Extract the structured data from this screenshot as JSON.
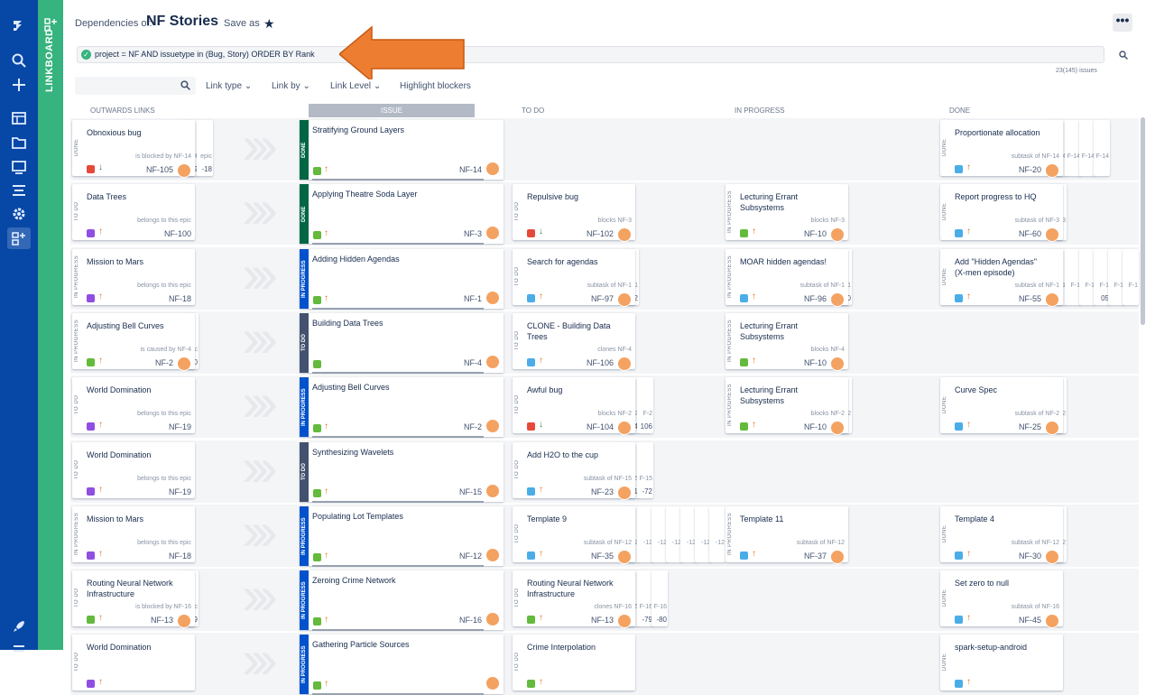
{
  "nav": {
    "items": [
      "jira-logo-icon",
      "search-icon",
      "create-icon",
      "boards-icon",
      "projects-icon",
      "dashboards-icon",
      "filters-icon",
      "settings-icon",
      "linkboard-icon"
    ],
    "bottom": [
      "rocket-icon",
      "menu-icon"
    ]
  },
  "sidebar": {
    "label": "LINKBOARD"
  },
  "header": {
    "prefix": "Dependencies of:",
    "title": "NF Stories",
    "save_as": "Save as",
    "more": "•••"
  },
  "jql": {
    "query": "project = NF AND issuetype in (Bug, Story) ORDER BY Rank",
    "count": "23(145) issues"
  },
  "filters": {
    "link_type": "Link type",
    "link_by": "Link by",
    "link_level": "Link Level",
    "highlight": "Highlight blockers"
  },
  "columns": {
    "outwards": "OUTWARDS LINKS",
    "issue": "ISSUE",
    "todo": "TO DO",
    "in_progress": "IN PROGRESS",
    "done": "DONE"
  },
  "colors": {
    "nav": "#0747a6",
    "sidebar": "#36b37e",
    "done_bar": "#006644",
    "in_progress_bar": "#0052cc",
    "todo_bar": "#42526e",
    "arrow": "#ed7d31"
  },
  "rows": [
    {
      "out": {
        "status": "DONE",
        "title": "Obnoxious bug",
        "sub": "is blocked by NF-14",
        "key": "NF-105",
        "type": "bug",
        "prio": "low",
        "ghosts": [
          {
            "s": "F-14",
            "k": "-99"
          },
          {
            "s": "epic",
            "k": "-18"
          }
        ]
      },
      "issue": {
        "status": "DONE",
        "title": "Stratifying Ground Layers",
        "key": "NF-14",
        "type": "story",
        "prio": "high"
      },
      "todo": null,
      "inprog": null,
      "done": {
        "status": "DONE",
        "title": "Proportionate allocation",
        "sub": "subtask of NF-14",
        "key": "NF-20",
        "type": "subtask",
        "prio": "high",
        "ghosts": [
          {
            "s": "F-14",
            "k": ""
          },
          {
            "s": "F-14",
            "k": ""
          },
          {
            "s": "F-14",
            "k": ""
          },
          {
            "s": "F-14",
            "k": ""
          }
        ]
      }
    },
    {
      "out": {
        "status": "TO DO",
        "title": "Data Trees",
        "sub": "belongs to this epic",
        "key": "NF-100",
        "type": "epic",
        "prio": "high"
      },
      "issue": {
        "status": "DONE",
        "title": "Applying Theatre Soda Layer",
        "key": "NF-3",
        "type": "story",
        "prio": "high"
      },
      "todo": {
        "status": "TO DO",
        "title": "Repulsive bug",
        "sub": "blocks NF-3",
        "key": "NF-102",
        "type": "bug",
        "prio": "low"
      },
      "inprog": {
        "status": "IN PROGRESS",
        "title": "Lecturing Errant Subsystems",
        "sub": "blocks NF-3",
        "key": "NF-10",
        "type": "story",
        "prio": "high"
      },
      "done": {
        "status": "DONE",
        "title": "Report progress to HQ",
        "sub": "subtask of NF-3",
        "key": "NF-60",
        "type": "subtask",
        "prio": "high",
        "ghosts": [
          {
            "s": "F-3",
            "k": ""
          }
        ]
      }
    },
    {
      "out": {
        "status": "IN PROGRESS",
        "title": "Mission to Mars",
        "sub": "belongs to this epic",
        "key": "NF-18",
        "type": "epic",
        "prio": "high"
      },
      "issue": {
        "status": "IN PROGRESS",
        "title": "Adding Hidden Agendas",
        "key": "NF-1",
        "type": "story",
        "prio": "high"
      },
      "todo": {
        "status": "TO DO",
        "title": "Search for agendas",
        "sub": "subtask of NF-1",
        "key": "NF-97",
        "type": "subtask",
        "prio": "high",
        "ghosts": [
          {
            "s": "F-1",
            "k": "102"
          }
        ]
      },
      "inprog": {
        "status": "IN PROGRESS",
        "title": "MOAR hidden agendas!",
        "sub": "subtask of NF-1",
        "key": "NF-96",
        "type": "subtask",
        "prio": "high",
        "ghosts": [
          {
            "s": "F-1",
            "k": "-10"
          }
        ]
      },
      "done": {
        "status": "DONE",
        "title": "Add \"Hidden Agendas\" (X-men episode)",
        "sub": "subtask of NF-1",
        "key": "NF-55",
        "type": "subtask",
        "prio": "high",
        "ghosts": [
          {
            "s": "F-1",
            "k": ""
          },
          {
            "s": "F-1",
            "k": ""
          },
          {
            "s": "F-1",
            "k": ""
          },
          {
            "s": "F-1",
            "k": "05"
          },
          {
            "s": "F-1",
            "k": ""
          },
          {
            "s": "F-1",
            "k": ""
          }
        ]
      }
    },
    {
      "out": {
        "status": "IN PROGRESS",
        "title": "Adjusting Bell Curves",
        "sub": "is caused by NF-4",
        "key": "NF-2",
        "type": "story",
        "prio": "high",
        "ghosts": [
          {
            "s": "epic",
            "k": "100"
          }
        ]
      },
      "issue": {
        "status": "TO DO",
        "title": "Building Data Trees",
        "key": "NF-4",
        "type": "story",
        "prio": "none"
      },
      "todo": {
        "status": "TO DO",
        "title": "CLONE - Building Data Trees",
        "sub": "clones NF-4",
        "key": "NF-106",
        "type": "task",
        "prio": "high"
      },
      "inprog": {
        "status": "IN PROGRESS",
        "title": "Lecturing Errant Subsystems",
        "sub": "blocks NF-4",
        "key": "NF-10",
        "type": "story",
        "prio": "high"
      },
      "done": null
    },
    {
      "out": {
        "status": "TO DO",
        "title": "World Domination",
        "sub": "belongs to this epic",
        "key": "NF-19",
        "type": "epic",
        "prio": "high"
      },
      "issue": {
        "status": "IN PROGRESS",
        "title": "Adjusting Bell Curves",
        "key": "NF-2",
        "type": "story",
        "prio": "high"
      },
      "todo": {
        "status": "TO DO",
        "title": "Awful bug",
        "sub": "blocks NF-2",
        "key": "NF-104",
        "type": "bug",
        "prio": "low",
        "ghosts": [
          {
            "s": "F-2",
            "k": "-4"
          },
          {
            "s": "F-2",
            "k": "106"
          }
        ]
      },
      "inprog": {
        "status": "IN PROGRESS",
        "title": "Lecturing Errant Subsystems",
        "sub": "blocks NF-2",
        "key": "NF-10",
        "type": "story",
        "prio": "high",
        "ghosts": [
          {
            "s": "F-2",
            "k": ""
          }
        ]
      },
      "done": {
        "status": "DONE",
        "title": "Curve Spec",
        "sub": "subtask of NF-2",
        "key": "NF-25",
        "type": "subtask",
        "prio": "high",
        "ghosts": [
          {
            "s": "F-2",
            "k": ""
          }
        ]
      }
    },
    {
      "out": {
        "status": "TO DO",
        "title": "World Domination",
        "sub": "belongs to this epic",
        "key": "NF-19",
        "type": "epic",
        "prio": "high"
      },
      "issue": {
        "status": "TO DO",
        "title": "Synthesizing Wavelets",
        "key": "NF-15",
        "type": "story",
        "prio": "high"
      },
      "todo": {
        "status": "TO DO",
        "title": "Add H2O to the cup",
        "sub": "subtask of NF-15",
        "key": "NF-23",
        "type": "subtask",
        "prio": "high",
        "ghosts": [
          {
            "s": "F-15",
            "k": "-71"
          },
          {
            "s": "F-15",
            "k": "-72"
          }
        ]
      },
      "inprog": null,
      "done": null
    },
    {
      "out": {
        "status": "IN PROGRESS",
        "title": "Mission to Mars",
        "sub": "belongs to this epic",
        "key": "NF-18",
        "type": "epic",
        "prio": "high"
      },
      "issue": {
        "status": "IN PROGRESS",
        "title": "Populating Lot Templates",
        "key": "NF-12",
        "type": "story",
        "prio": "high"
      },
      "todo": {
        "status": "TO DO",
        "title": "Template 9",
        "sub": "subtask of NF-12",
        "key": "NF-35",
        "type": "subtask",
        "prio": "high",
        "ghosts": [
          {
            "s": "-12",
            "k": ""
          },
          {
            "s": "-12",
            "k": ""
          },
          {
            "s": "-12",
            "k": ""
          },
          {
            "s": "-12",
            "k": ""
          },
          {
            "s": "-12",
            "k": ""
          },
          {
            "s": "-12",
            "k": ""
          },
          {
            "s": "-12",
            "k": ""
          }
        ]
      },
      "inprog": {
        "status": "IN PROGRESS",
        "title": "Template 11",
        "sub": "subtask of NF-12",
        "key": "NF-37",
        "type": "subtask",
        "prio": "high"
      },
      "done": {
        "status": "DONE",
        "title": "Template 4",
        "sub": "subtask of NF-12",
        "key": "NF-30",
        "type": "subtask",
        "prio": "high",
        "ghosts": [
          {
            "s": "F-12",
            "k": ""
          }
        ]
      }
    },
    {
      "out": {
        "status": "TO DO",
        "title": "Routing Neural Network Infrastructure",
        "sub": "is blocked by NF-16",
        "key": "NF-13",
        "type": "story",
        "prio": "high",
        "ghosts": [
          {
            "s": "epic",
            "k": "-99"
          }
        ]
      },
      "issue": {
        "status": "IN PROGRESS",
        "title": "Zeroing Crime Network",
        "key": "NF-16",
        "type": "story",
        "prio": "high"
      },
      "todo": {
        "status": "TO DO",
        "title": "Routing Neural Network Infrastructure",
        "sub": "clones NF-16",
        "key": "NF-13",
        "type": "story",
        "prio": "high",
        "ghosts": [
          {
            "s": "F-16",
            "k": ""
          },
          {
            "s": "F-16",
            "k": "-79"
          },
          {
            "s": "F-16",
            "k": "-80"
          }
        ]
      },
      "inprog": null,
      "done": {
        "status": "DONE",
        "title": "Set zero to null",
        "sub": "subtask of NF-16",
        "key": "NF-45",
        "type": "subtask",
        "prio": "high"
      }
    },
    {
      "out": {
        "status": "TO DO",
        "title": "World Domination",
        "sub": "",
        "key": "",
        "type": "epic",
        "prio": "high"
      },
      "issue": {
        "status": "IN PROGRESS",
        "title": "Gathering Particle Sources",
        "key": "",
        "type": "story",
        "prio": "high"
      },
      "todo": {
        "status": "TO DO",
        "title": "Crime Interpolation",
        "sub": "",
        "key": "",
        "type": "story",
        "prio": "high"
      },
      "inprog": null,
      "done": {
        "status": "DONE",
        "title": "spark-setup-android",
        "sub": "",
        "key": "",
        "type": "subtask",
        "prio": "high"
      }
    }
  ]
}
